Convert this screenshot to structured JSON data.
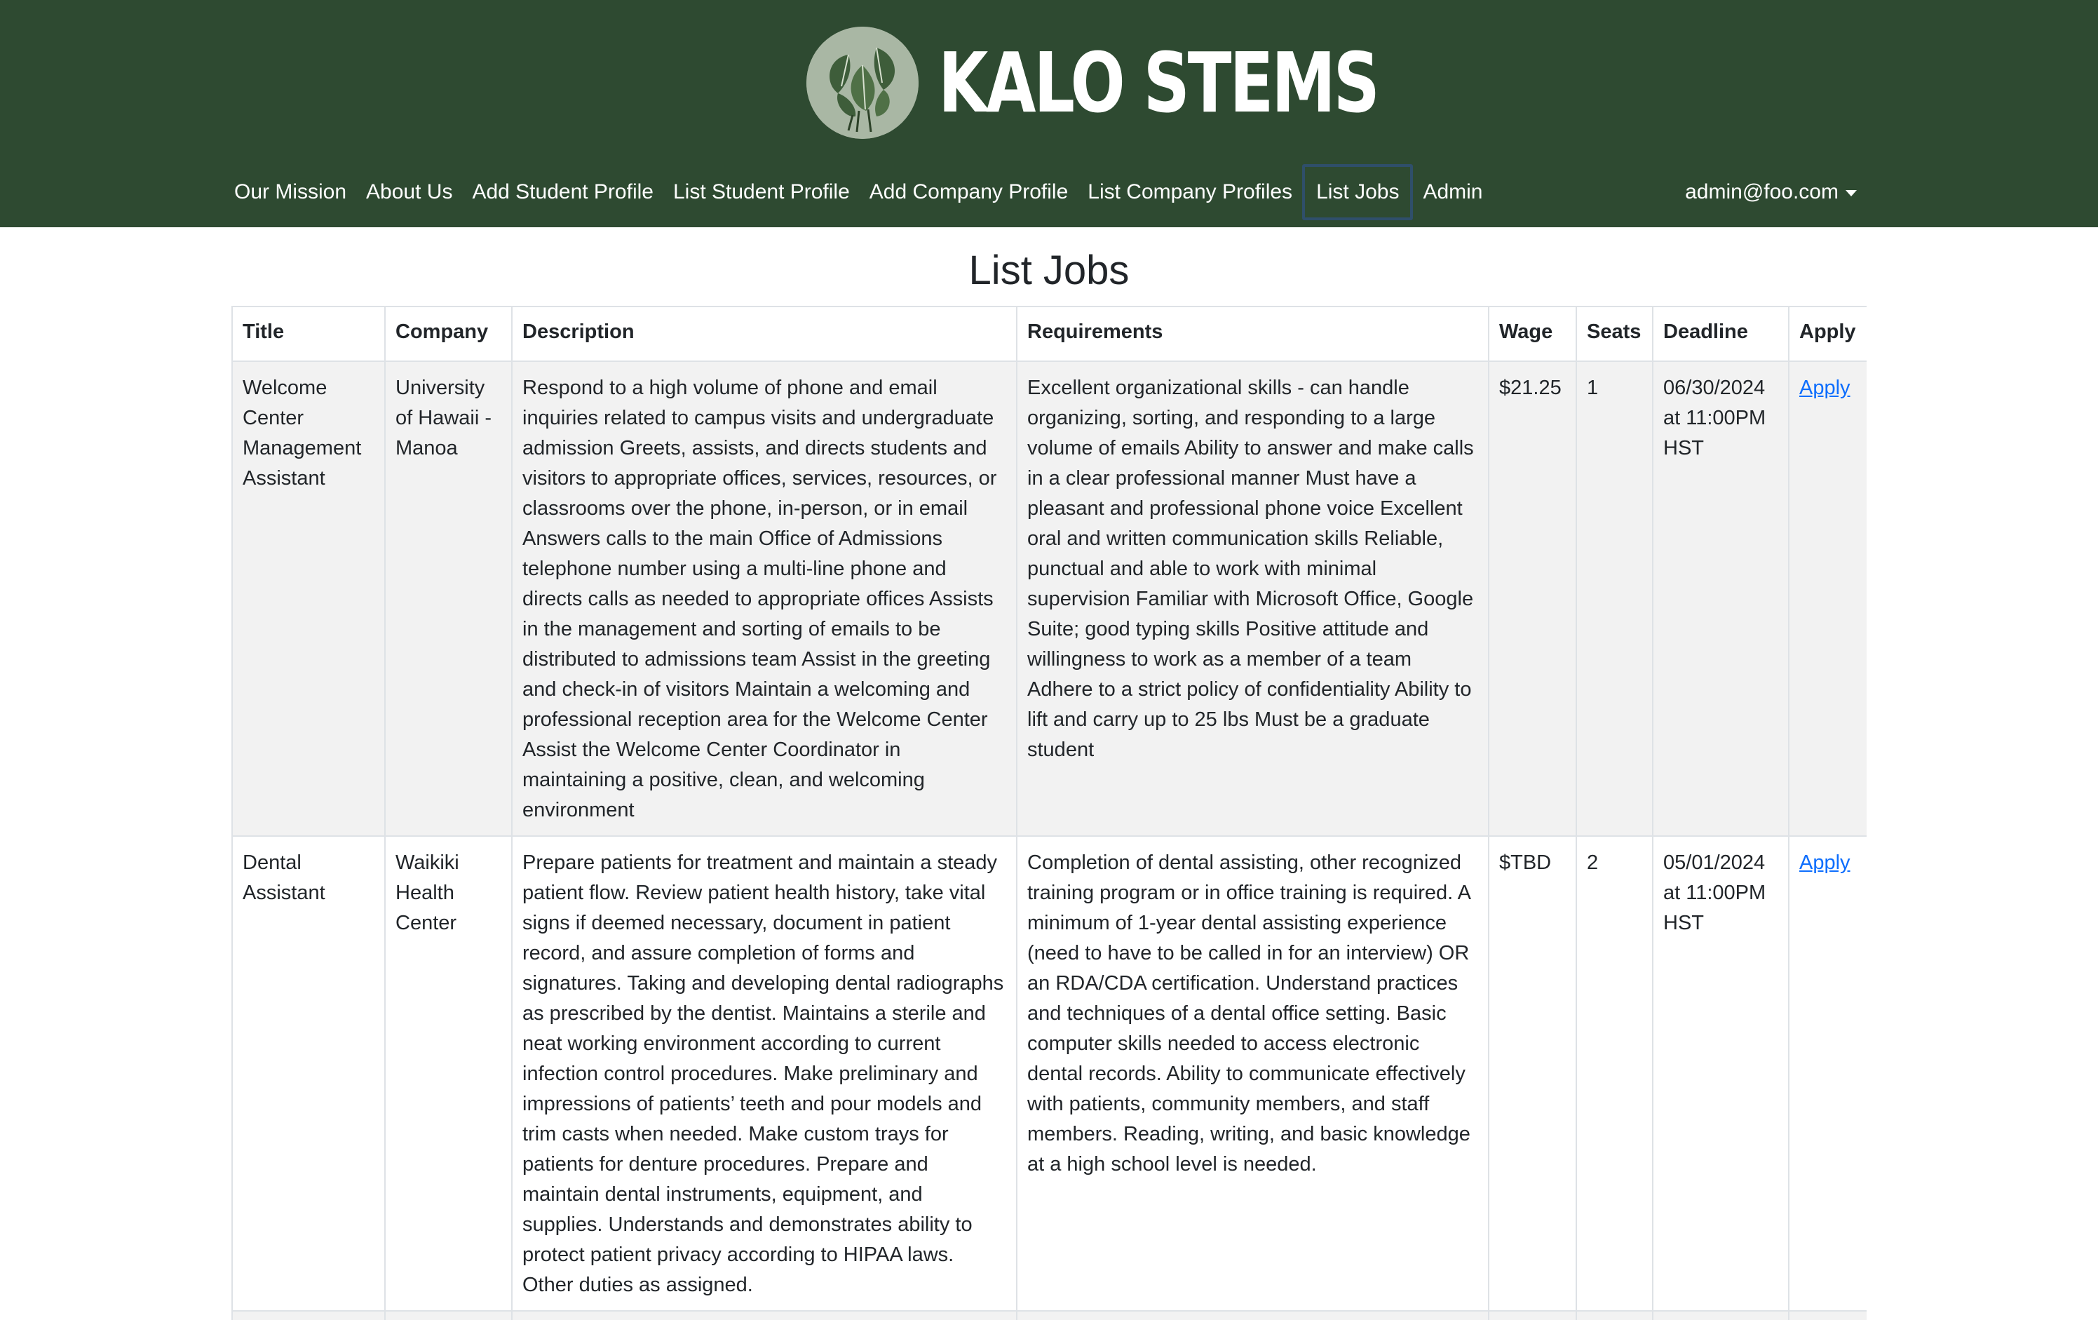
{
  "brand": {
    "name": "KALO STEMS",
    "logo_icon": "taro-leaf-logo"
  },
  "nav": {
    "items": [
      {
        "label": "Our Mission"
      },
      {
        "label": "About Us"
      },
      {
        "label": "Add Student Profile"
      },
      {
        "label": "List Student Profile"
      },
      {
        "label": "Add Company Profile"
      },
      {
        "label": "List Company Profiles"
      },
      {
        "label": "List Jobs",
        "active": true
      },
      {
        "label": "Admin"
      }
    ],
    "user": "admin@foo.com"
  },
  "page": {
    "title": "List Jobs"
  },
  "table": {
    "headers": {
      "title": "Title",
      "company": "Company",
      "description": "Description",
      "requirements": "Requirements",
      "wage": "Wage",
      "seats": "Seats",
      "deadline": "Deadline",
      "apply": "Apply"
    },
    "rows": [
      {
        "title": "Welcome Center Management Assistant",
        "company": "University of Hawaii - Manoa",
        "description": "Respond to a high volume of phone and email inquiries related to campus visits and undergraduate admission Greets, assists, and directs students and visitors to appropriate offices, services, resources, or classrooms over the phone, in-person, or in email Answers calls to the main Office of Admissions telephone number using a multi-line phone and directs calls as needed to appropriate offices Assists in the management and sorting of emails to be distributed to admissions team Assist in the greeting and check-in of visitors Maintain a welcoming and professional reception area for the Welcome Center Assist the Welcome Center Coordinator in maintaining a positive, clean, and welcoming environment",
        "requirements": "Excellent organizational skills - can handle organizing, sorting, and responding to a large volume of emails Ability to answer and make calls in a clear professional manner Must have a pleasant and professional phone voice Excellent oral and written communication skills Reliable, punctual and able to work with minimal supervision Familiar with Microsoft Office, Google Suite; good typing skills Positive attitude and willingness to work as a member of a team Adhere to a strict policy of confidentiality Ability to lift and carry up to 25 lbs Must be a graduate student",
        "wage": "$21.25",
        "seats": "1",
        "deadline": "06/30/2024 at 11:00PM HST",
        "apply": "Apply"
      },
      {
        "title": "Dental Assistant",
        "company": "Waikiki Health Center",
        "description": "Prepare patients for treatment and maintain a steady patient flow. Review patient health history, take vital signs if deemed necessary, document in patient record, and assure completion of forms and signatures. Taking and developing dental radiographs as prescribed by the dentist. Maintains a sterile and neat working environment according to current infection control procedures. Make preliminary and impressions of patients’ teeth and pour models and trim casts when needed. Make custom trays for patients for denture procedures. Prepare and maintain dental instruments, equipment, and supplies. Understands and demonstrates ability to protect patient privacy according to HIPAA laws. Other duties as assigned.",
        "requirements": "Completion of dental assisting, other recognized training program or in office training is required. A minimum of 1-year dental assisting experience (need to have to be called in for an interview) OR an RDA/CDA certification. Understand practices and techniques of a dental office setting. Basic computer skills needed to access electronic dental records. Ability to communicate effectively with patients, community members, and staff members. Reading, writing, and basic knowledge at a high school level is needed.",
        "wage": "$TBD",
        "seats": "2",
        "deadline": "05/01/2024 at 11:00PM HST",
        "apply": "Apply"
      }
    ]
  }
}
